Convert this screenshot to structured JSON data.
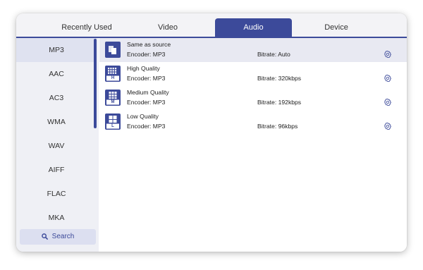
{
  "tabs": [
    {
      "label": "Recently Used"
    },
    {
      "label": "Video"
    },
    {
      "label": "Audio"
    },
    {
      "label": "Device"
    }
  ],
  "active_tab": "Audio",
  "formats": [
    {
      "label": "MP3"
    },
    {
      "label": "AAC"
    },
    {
      "label": "AC3"
    },
    {
      "label": "WMA"
    },
    {
      "label": "WAV"
    },
    {
      "label": "AIFF"
    },
    {
      "label": "FLAC"
    },
    {
      "label": "MKA"
    }
  ],
  "selected_format": "MP3",
  "search": {
    "label": "Search"
  },
  "presets": [
    {
      "name": "Same as source",
      "encoder": "Encoder: MP3",
      "bitrate": "Bitrate: Auto",
      "badge": "",
      "icon": "copy-icon"
    },
    {
      "name": "High Quality",
      "encoder": "Encoder: MP3",
      "bitrate": "Bitrate: 320kbps",
      "badge": "H",
      "icon": "high-quality-icon"
    },
    {
      "name": "Medium Quality",
      "encoder": "Encoder: MP3",
      "bitrate": "Bitrate: 192kbps",
      "badge": "M",
      "icon": "medium-quality-icon"
    },
    {
      "name": "Low Quality",
      "encoder": "Encoder: MP3",
      "bitrate": "Bitrate: 96kbps",
      "badge": "L",
      "icon": "low-quality-icon"
    }
  ],
  "colors": {
    "accent": "#3c4a9a",
    "sidebar_bg": "#eff0f5",
    "selected_row": "#e8e9f2"
  }
}
